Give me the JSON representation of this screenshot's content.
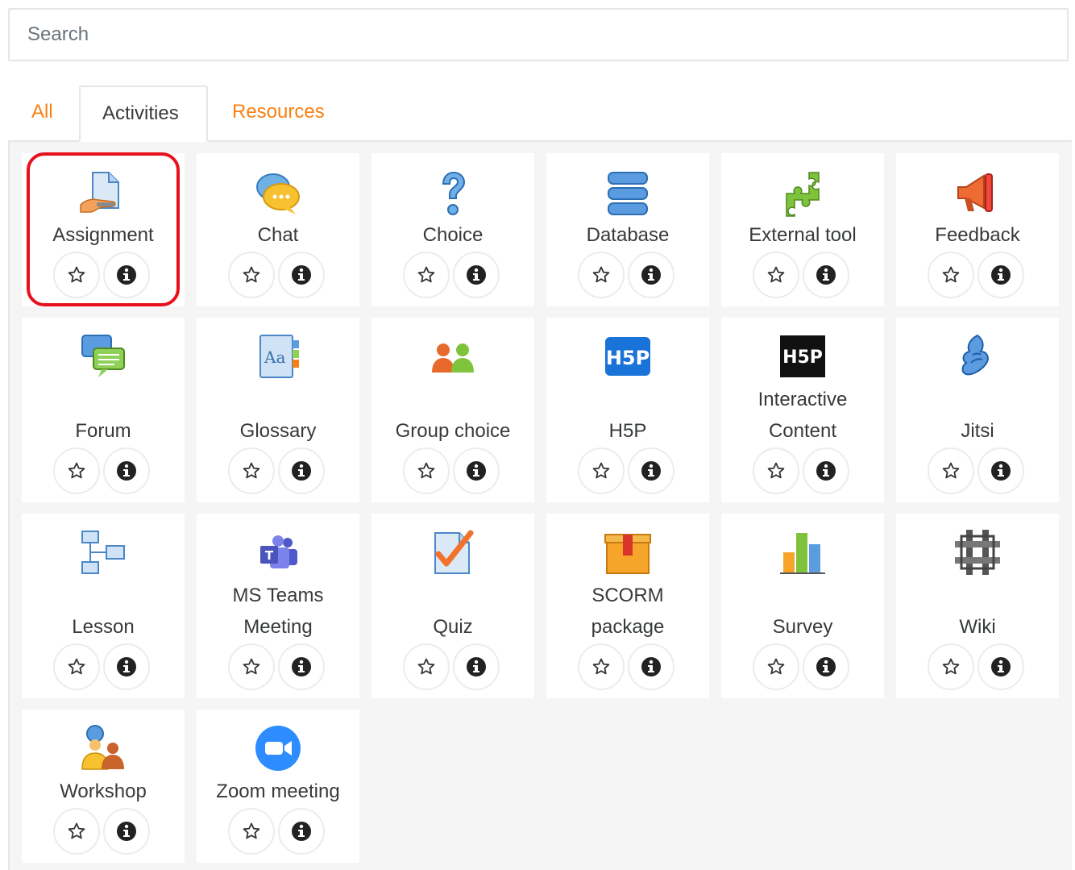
{
  "search": {
    "placeholder": "Search"
  },
  "tabs": [
    {
      "label": "All",
      "active": false
    },
    {
      "label": "Activities",
      "active": true
    },
    {
      "label": "Resources",
      "active": false
    }
  ],
  "colors": {
    "tab_link": "#f98012",
    "highlight": "#e8101c",
    "panel_bg": "#f5f5f5"
  },
  "modules": [
    {
      "line1": "Assignment",
      "line2": "",
      "icon": "assignment-icon",
      "highlighted": true
    },
    {
      "line1": "Chat",
      "line2": "",
      "icon": "chat-icon"
    },
    {
      "line1": "Choice",
      "line2": "",
      "icon": "choice-icon"
    },
    {
      "line1": "Database",
      "line2": "",
      "icon": "database-icon"
    },
    {
      "line1": "External tool",
      "line2": "",
      "icon": "external-tool-icon"
    },
    {
      "line1": "Feedback",
      "line2": "",
      "icon": "feedback-icon"
    },
    {
      "line1": "Forum",
      "line2": "",
      "icon": "forum-icon"
    },
    {
      "line1": "Glossary",
      "line2": "",
      "icon": "glossary-icon"
    },
    {
      "line1": "Group choice",
      "line2": "",
      "icon": "group-choice-icon"
    },
    {
      "line1": "H5P",
      "line2": "",
      "icon": "h5p-icon"
    },
    {
      "line1": "Interactive",
      "line2": "Content",
      "icon": "interactive-content-icon"
    },
    {
      "line1": "Jitsi",
      "line2": "",
      "icon": "jitsi-icon"
    },
    {
      "line1": "Lesson",
      "line2": "",
      "icon": "lesson-icon"
    },
    {
      "line1": "MS Teams",
      "line2": "Meeting",
      "icon": "ms-teams-icon"
    },
    {
      "line1": "Quiz",
      "line2": "",
      "icon": "quiz-icon"
    },
    {
      "line1": "SCORM",
      "line2": "package",
      "icon": "scorm-icon"
    },
    {
      "line1": "Survey",
      "line2": "",
      "icon": "survey-icon"
    },
    {
      "line1": "Wiki",
      "line2": "",
      "icon": "wiki-icon"
    },
    {
      "line1": "Workshop",
      "line2": "",
      "icon": "workshop-icon"
    },
    {
      "line1": "Zoom meeting",
      "line2": "",
      "icon": "zoom-icon"
    }
  ]
}
